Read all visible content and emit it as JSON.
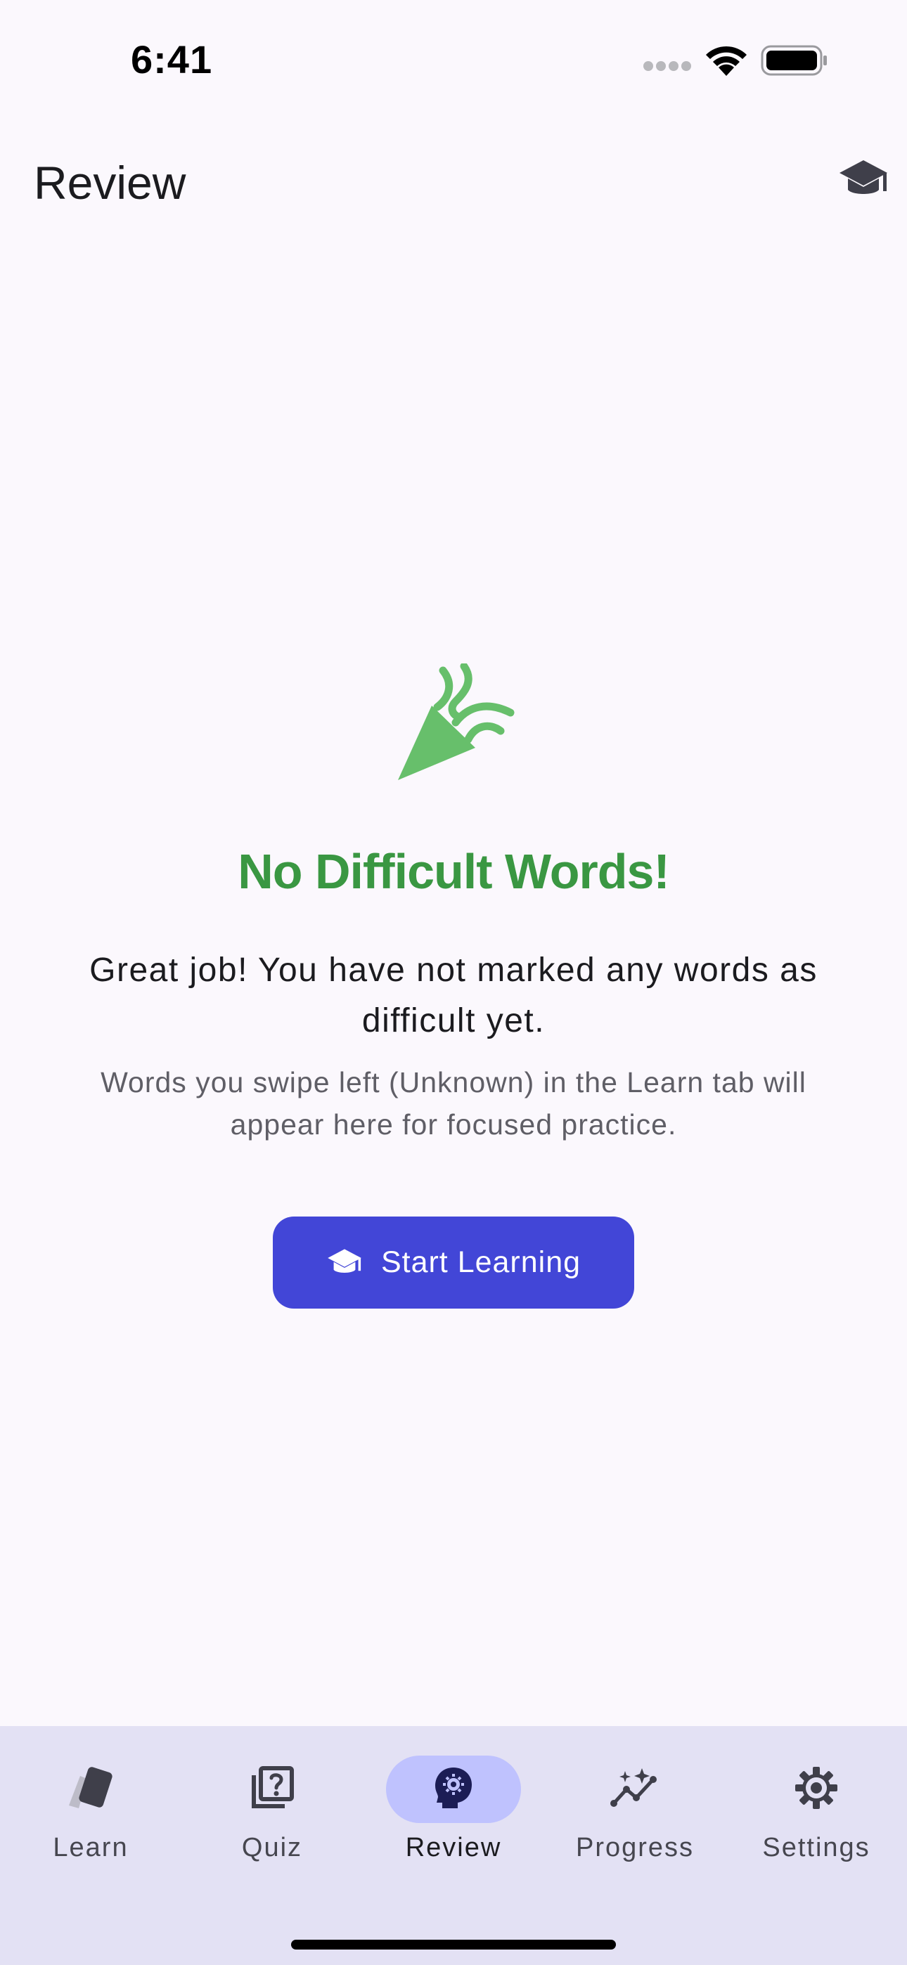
{
  "status_bar": {
    "time": "6:41"
  },
  "app_bar": {
    "title": "Review",
    "action_icon": "graduation-cap-icon"
  },
  "empty_state": {
    "icon": "celebration-icon",
    "title": "No Difficult Words!",
    "message": "Great job! You have not marked any words as difficult yet.",
    "hint": "Words you swipe left (Unknown) in the Learn tab will appear here for focused practice.",
    "button_label": "Start Learning",
    "button_icon": "graduation-cap-icon"
  },
  "bottom_nav": {
    "items": [
      {
        "label": "Learn",
        "icon": "cards-icon",
        "active": false
      },
      {
        "label": "Quiz",
        "icon": "quiz-icon",
        "active": false
      },
      {
        "label": "Review",
        "icon": "psychology-icon",
        "active": true
      },
      {
        "label": "Progress",
        "icon": "insights-icon",
        "active": false
      },
      {
        "label": "Settings",
        "icon": "gear-icon",
        "active": false
      }
    ]
  },
  "colors": {
    "background": "#FBF8FD",
    "accent": "#4246D7",
    "success": "#3A9742",
    "nav_background": "#E3E1F4",
    "nav_active_pill": "#BFC2FE"
  }
}
